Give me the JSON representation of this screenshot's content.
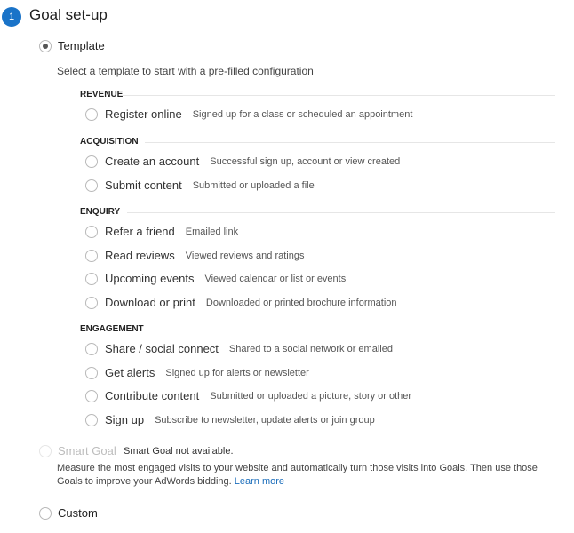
{
  "step": {
    "number": "1",
    "title": "Goal set-up"
  },
  "template_option": {
    "label": "Template",
    "selected": true
  },
  "template_subtitle": "Select a template to start with a pre-filled configuration",
  "sections": [
    {
      "header": "REVENUE",
      "items": [
        {
          "label": "Register online",
          "desc": "Signed up for a class or scheduled an appointment"
        }
      ]
    },
    {
      "header": "ACQUISITION",
      "items": [
        {
          "label": "Create an account",
          "desc": "Successful sign up, account or view created"
        },
        {
          "label": "Submit content",
          "desc": "Submitted or uploaded a file"
        }
      ]
    },
    {
      "header": "ENQUIRY",
      "items": [
        {
          "label": "Refer a friend",
          "desc": "Emailed link"
        },
        {
          "label": "Read reviews",
          "desc": "Viewed reviews and ratings"
        },
        {
          "label": "Upcoming events",
          "desc": "Viewed calendar or list or events"
        },
        {
          "label": "Download or print",
          "desc": "Downloaded or printed brochure information"
        }
      ]
    },
    {
      "header": "ENGAGEMENT",
      "items": [
        {
          "label": "Share / social connect",
          "desc": "Shared to a social network or emailed"
        },
        {
          "label": "Get alerts",
          "desc": "Signed up for alerts or newsletter"
        },
        {
          "label": "Contribute content",
          "desc": "Submitted or uploaded a picture, story or other"
        },
        {
          "label": "Sign up",
          "desc": "Subscribe to newsletter, update alerts or join group"
        }
      ]
    }
  ],
  "smart_goal": {
    "label": "Smart Goal",
    "status": "Smart Goal not available.",
    "description": "Measure the most engaged visits to your website and automatically turn those visits into Goals. Then use those Goals to improve your AdWords bidding.",
    "link": "Learn more",
    "disabled": true
  },
  "custom_option": {
    "label": "Custom"
  }
}
